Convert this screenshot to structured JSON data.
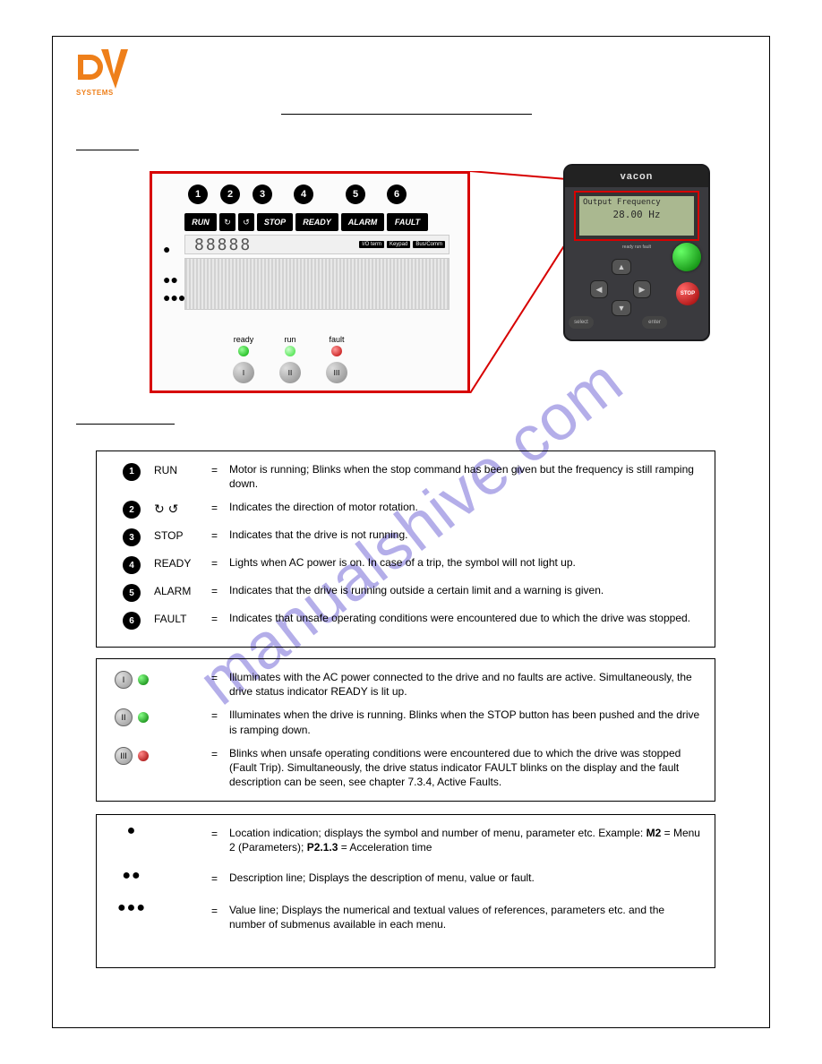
{
  "logo": {
    "brand_top": "D",
    "brand_accent": "V",
    "subtitle": "SYSTEMS"
  },
  "watermark": "manualshive.com",
  "zoom": {
    "numbers": [
      "1",
      "2",
      "3",
      "4",
      "5",
      "6"
    ],
    "status": {
      "run": "RUN",
      "cw": "↻",
      "ccw": "↺",
      "stop": "STOP",
      "ready": "READY",
      "alarm": "ALARM",
      "fault": "FAULT"
    },
    "segment": "88888",
    "tags": [
      "I/O term",
      "Keypad",
      "Bus/Comm"
    ],
    "leds": {
      "ready": "ready",
      "run": "run",
      "fault": "fault",
      "r1": "I",
      "r2": "II",
      "r3": "III"
    }
  },
  "device": {
    "brand": "vacon",
    "lcd_line1": "Output Frequency",
    "lcd_line2": "28.00 Hz",
    "tiny": "ready  run  fault",
    "stop_label": "STOP",
    "select": "select",
    "enter": "enter"
  },
  "box1": {
    "items": [
      {
        "num": "1",
        "label": "RUN",
        "text": "Motor is running; Blinks when the stop command has been given but the frequency is still ramping down."
      },
      {
        "num": "2",
        "label": "↻ ↺",
        "text": "Indicates the direction of motor rotation."
      },
      {
        "num": "3",
        "label": "STOP",
        "text": "Indicates that the drive is not running."
      },
      {
        "num": "4",
        "label": "READY",
        "text": "Lights when AC power is on. In case of a trip, the symbol will not light up."
      },
      {
        "num": "5",
        "label": "ALARM",
        "text": "Indicates that the drive is running outside a certain limit and a warning is given."
      },
      {
        "num": "6",
        "label": "FAULT",
        "text": "Indicates that unsafe operating conditions were encountered due to which the drive was stopped."
      }
    ]
  },
  "box2": {
    "items": [
      {
        "roman": "I",
        "led": "g",
        "text": "Illuminates with the AC power connected to the drive and no faults are active. Simultaneously, the drive status indicator READY is lit up."
      },
      {
        "roman": "II",
        "led": "g",
        "text": "Illuminates when the drive is running. Blinks when the STOP button has been pushed and the drive is ramping down."
      },
      {
        "roman": "III",
        "led": "r",
        "text": "Blinks when unsafe operating conditions were encountered due to which the drive was stopped (Fault Trip). Simultaneously, the drive status indicator FAULT blinks on the display and the fault description can be seen, see chapter 7.3.4, Active Faults."
      }
    ]
  },
  "box3": {
    "items": [
      {
        "dots": "●",
        "text_pre": "Location indication; displays the symbol and number of menu, parameter etc. Example: ",
        "b1": "M2",
        "mid": " = Menu 2 (Parameters); ",
        "b2": "P2.1.3",
        "text_post": " = Acceleration time"
      },
      {
        "dots": "●●",
        "text": "Description line; Displays the description of menu, value or fault."
      },
      {
        "dots": "●●●",
        "text": "Value line; Displays the numerical and textual values of references, parameters etc. and the number of submenus available in each menu."
      }
    ]
  },
  "eq": "="
}
